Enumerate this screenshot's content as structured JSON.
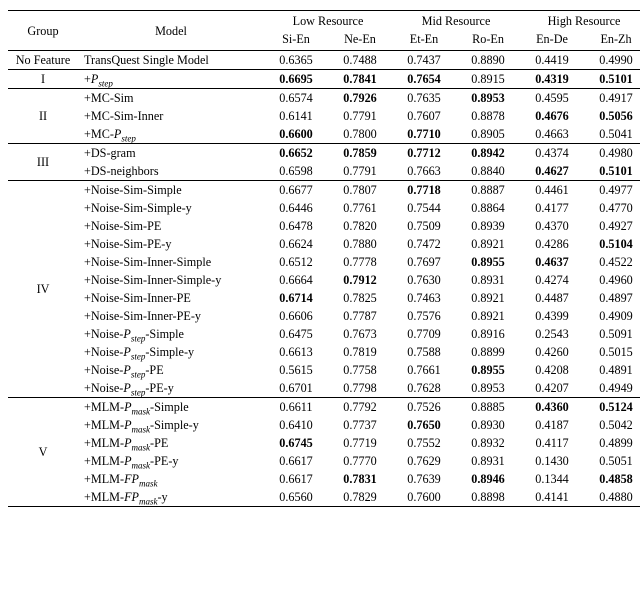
{
  "chart_data": {
    "type": "table",
    "title": "",
    "super_columns": [
      "Low Resource",
      "Mid Resource",
      "High Resource"
    ],
    "columns": [
      "Group",
      "Model",
      "Si-En",
      "Ne-En",
      "Et-En",
      "Ro-En",
      "En-De",
      "En-Zh"
    ],
    "rows": [
      {
        "group": "No Feature",
        "model_html": "TransQuest Single Model",
        "values": [
          0.6365,
          0.7488,
          0.7437,
          0.889,
          0.4419,
          0.499
        ],
        "bold": [
          false,
          false,
          false,
          false,
          false,
          false
        ],
        "sep": true
      },
      {
        "group": "I",
        "model_html": "+<span class='it'>P</span><sub>step</sub>",
        "values": [
          0.6695,
          0.7841,
          0.7654,
          0.8915,
          0.4319,
          0.5101
        ],
        "bold": [
          true,
          true,
          true,
          false,
          true,
          true
        ],
        "sep": true
      },
      {
        "group": "II",
        "model_html": "+MC-Sim",
        "values": [
          0.6574,
          0.7926,
          0.7635,
          0.8953,
          0.4595,
          0.4917
        ],
        "bold": [
          false,
          true,
          false,
          true,
          false,
          false
        ],
        "sep": true
      },
      {
        "group": "II",
        "model_html": "+MC-Sim-Inner",
        "values": [
          0.6141,
          0.7791,
          0.7607,
          0.8878,
          0.4676,
          0.5056
        ],
        "bold": [
          false,
          false,
          false,
          false,
          true,
          true
        ],
        "sep": false
      },
      {
        "group": "II",
        "model_html": "+MC-<span class='it'>P</span><sub>step</sub>",
        "values": [
          0.66,
          0.78,
          0.771,
          0.8905,
          0.4663,
          0.5041
        ],
        "bold": [
          true,
          false,
          true,
          false,
          false,
          false
        ],
        "sep": false
      },
      {
        "group": "III",
        "model_html": "+DS-gram",
        "values": [
          0.6652,
          0.7859,
          0.7712,
          0.8942,
          0.4374,
          0.498
        ],
        "bold": [
          true,
          true,
          true,
          true,
          false,
          false
        ],
        "sep": true
      },
      {
        "group": "III",
        "model_html": "+DS-neighbors",
        "values": [
          0.6598,
          0.7791,
          0.7663,
          0.884,
          0.4627,
          0.5101
        ],
        "bold": [
          false,
          false,
          false,
          false,
          true,
          true
        ],
        "sep": false
      },
      {
        "group": "IV",
        "model_html": "+Noise-Sim-Simple",
        "values": [
          0.6677,
          0.7807,
          0.7718,
          0.8887,
          0.4461,
          0.4977
        ],
        "bold": [
          false,
          false,
          true,
          false,
          false,
          false
        ],
        "sep": true
      },
      {
        "group": "IV",
        "model_html": "+Noise-Sim-Simple-y",
        "values": [
          0.6446,
          0.7761,
          0.7544,
          0.8864,
          0.4177,
          0.477
        ],
        "bold": [
          false,
          false,
          false,
          false,
          false,
          false
        ],
        "sep": false
      },
      {
        "group": "IV",
        "model_html": "+Noise-Sim-PE",
        "values": [
          0.6478,
          0.782,
          0.7509,
          0.8939,
          0.437,
          0.4927
        ],
        "bold": [
          false,
          false,
          false,
          false,
          false,
          false
        ],
        "sep": false
      },
      {
        "group": "IV",
        "model_html": "+Noise-Sim-PE-y",
        "values": [
          0.6624,
          0.788,
          0.7472,
          0.8921,
          0.4286,
          0.5104
        ],
        "bold": [
          false,
          false,
          false,
          false,
          false,
          true
        ],
        "sep": false
      },
      {
        "group": "IV",
        "model_html": "+Noise-Sim-Inner-Simple",
        "values": [
          0.6512,
          0.7778,
          0.7697,
          0.8955,
          0.4637,
          0.4522
        ],
        "bold": [
          false,
          false,
          false,
          true,
          true,
          false
        ],
        "sep": false
      },
      {
        "group": "IV",
        "model_html": "+Noise-Sim-Inner-Simple-y",
        "values": [
          0.6664,
          0.7912,
          0.763,
          0.8931,
          0.4274,
          0.496
        ],
        "bold": [
          false,
          true,
          false,
          false,
          false,
          false
        ],
        "sep": false
      },
      {
        "group": "IV",
        "model_html": "+Noise-Sim-Inner-PE",
        "values": [
          0.6714,
          0.7825,
          0.7463,
          0.8921,
          0.4487,
          0.4897
        ],
        "bold": [
          true,
          false,
          false,
          false,
          false,
          false
        ],
        "sep": false
      },
      {
        "group": "IV",
        "model_html": "+Noise-Sim-Inner-PE-y",
        "values": [
          0.6606,
          0.7787,
          0.7576,
          0.8921,
          0.4399,
          0.4909
        ],
        "bold": [
          false,
          false,
          false,
          false,
          false,
          false
        ],
        "sep": false
      },
      {
        "group": "IV",
        "model_html": "+Noise-<span class='it'>P</span><sub>step</sub>-Simple",
        "values": [
          0.6475,
          0.7673,
          0.7709,
          0.8916,
          0.2543,
          0.5091
        ],
        "bold": [
          false,
          false,
          false,
          false,
          false,
          false
        ],
        "sep": false
      },
      {
        "group": "IV",
        "model_html": "+Noise-<span class='it'>P</span><sub>step</sub>-Simple-y",
        "values": [
          0.6613,
          0.7819,
          0.7588,
          0.8899,
          0.426,
          0.5015
        ],
        "bold": [
          false,
          false,
          false,
          false,
          false,
          false
        ],
        "sep": false
      },
      {
        "group": "IV",
        "model_html": "+Noise-<span class='it'>P</span><sub>step</sub>-PE",
        "values": [
          0.5615,
          0.7758,
          0.7661,
          0.8955,
          0.4208,
          0.4891
        ],
        "bold": [
          false,
          false,
          false,
          true,
          false,
          false
        ],
        "sep": false
      },
      {
        "group": "IV",
        "model_html": "+Noise-<span class='it'>P</span><sub>step</sub>-PE-y",
        "values": [
          0.6701,
          0.7798,
          0.7628,
          0.8953,
          0.4207,
          0.4949
        ],
        "bold": [
          false,
          false,
          false,
          false,
          false,
          false
        ],
        "sep": false
      },
      {
        "group": "V",
        "model_html": "+MLM-<span class='it'>P</span><sub>mask</sub>-Simple",
        "values": [
          0.6611,
          0.7792,
          0.7526,
          0.8885,
          0.436,
          0.5124
        ],
        "bold": [
          false,
          false,
          false,
          false,
          true,
          true
        ],
        "sep": true
      },
      {
        "group": "V",
        "model_html": "+MLM-<span class='it'>P</span><sub>mask</sub>-Simple-y",
        "values": [
          0.641,
          0.7737,
          0.765,
          0.893,
          0.4187,
          0.5042
        ],
        "bold": [
          false,
          false,
          true,
          false,
          false,
          false
        ],
        "sep": false
      },
      {
        "group": "V",
        "model_html": "+MLM-<span class='it'>P</span><sub>mask</sub>-PE",
        "values": [
          0.6745,
          0.7719,
          0.7552,
          0.8932,
          0.4117,
          0.4899
        ],
        "bold": [
          true,
          false,
          false,
          false,
          false,
          false
        ],
        "sep": false
      },
      {
        "group": "V",
        "model_html": "+MLM-<span class='it'>P</span><sub>mask</sub>-PE-y",
        "values": [
          0.6617,
          0.777,
          0.7629,
          0.8931,
          0.143,
          0.5051
        ],
        "bold": [
          false,
          false,
          false,
          false,
          false,
          false
        ],
        "sep": false
      },
      {
        "group": "V",
        "model_html": "+MLM-<span class='it'>FP</span><sub>mask</sub>",
        "values": [
          0.6617,
          0.7831,
          0.7639,
          0.8946,
          0.1344,
          0.4858
        ],
        "bold": [
          false,
          true,
          false,
          true,
          false,
          true
        ],
        "sep": false
      },
      {
        "group": "V",
        "model_html": "+MLM-<span class='it'>FP</span><sub>mask</sub>-y",
        "values": [
          0.656,
          0.7829,
          0.76,
          0.8898,
          0.4141,
          0.488
        ],
        "bold": [
          false,
          false,
          false,
          false,
          false,
          false
        ],
        "sep": false
      }
    ]
  },
  "labels": {
    "group": "Group",
    "model": "Model",
    "low": "Low Resource",
    "mid": "Mid Resource",
    "high": "High Resource",
    "sien": "Si-En",
    "neen": "Ne-En",
    "eten": "Et-En",
    "roen": "Ro-En",
    "ende": "En-De",
    "enzh": "En-Zh"
  }
}
